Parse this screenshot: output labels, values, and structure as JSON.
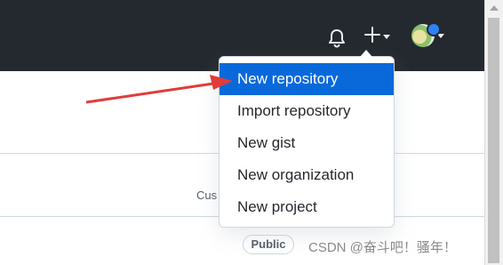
{
  "header": {
    "notifications_icon": "bell-icon",
    "create_icon": "plus-icon",
    "avatar_icon": "avatar-icon"
  },
  "menu": {
    "items": [
      {
        "label": "New repository",
        "active": true
      },
      {
        "label": "Import repository",
        "active": false
      },
      {
        "label": "New gist",
        "active": false
      },
      {
        "label": "New organization",
        "active": false
      },
      {
        "label": "New project",
        "active": false
      }
    ]
  },
  "content": {
    "truncated_text": "Cus",
    "public_badge": "Public"
  },
  "watermark": "CSDN @奋斗吧！骚年！",
  "colors": {
    "header_bg": "#24292f",
    "menu_active_bg": "#0969da",
    "annotation_arrow": "#e03c3c"
  }
}
